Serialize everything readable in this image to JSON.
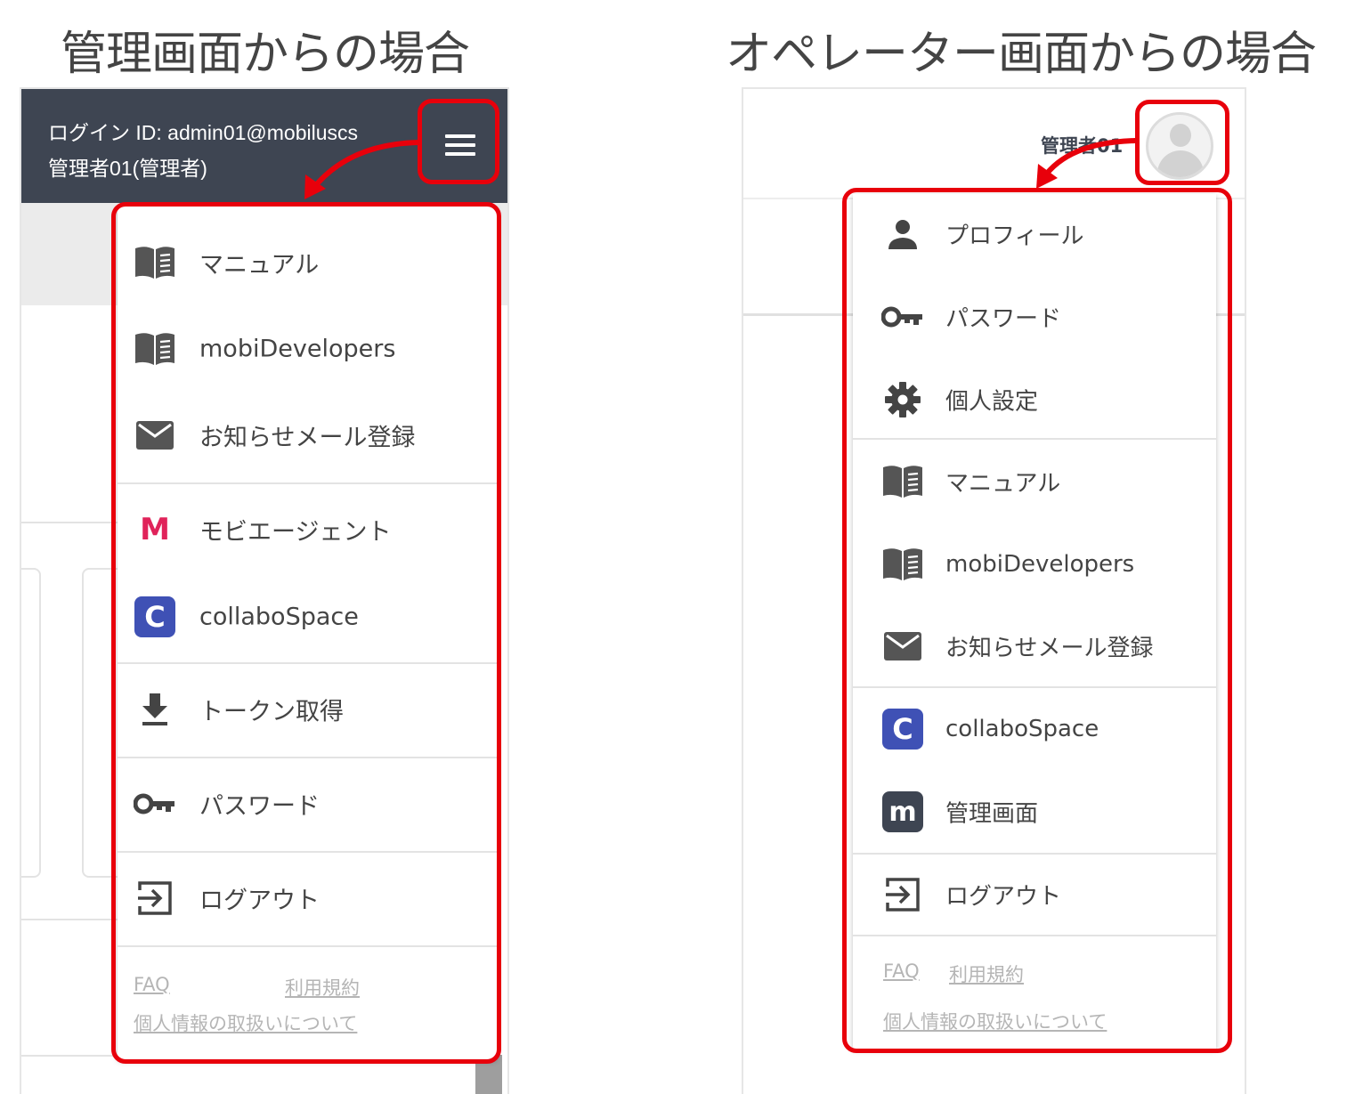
{
  "headings": {
    "admin": "管理画面からの場合",
    "operator": "オペレーター画面からの場合"
  },
  "admin_panel": {
    "login_id_line": "ログイン ID: admin01@mobiluscs",
    "user_line": "管理者01(管理者)",
    "menu_button_icon": "hamburger-icon",
    "menu": {
      "items": [
        {
          "label": "マニュアル",
          "icon": "book-icon"
        },
        {
          "label": "mobiDevelopers",
          "icon": "book-icon"
        },
        {
          "label": "お知らせメール登録",
          "icon": "mail-icon"
        },
        {
          "label": "モビエージェント",
          "icon": "mobi-agent-logo-icon"
        },
        {
          "label": "collaboSpace",
          "icon": "collabospace-logo-icon"
        },
        {
          "label": "トークン取得",
          "icon": "download-icon"
        },
        {
          "label": "パスワード",
          "icon": "key-icon"
        },
        {
          "label": "ログアウト",
          "icon": "logout-icon"
        }
      ],
      "footer": {
        "faq": "FAQ",
        "terms": "利用規約",
        "privacy": "個人情報の取扱いについて"
      }
    }
  },
  "operator_panel": {
    "user_name": "管理者01",
    "avatar_icon": "avatar-icon",
    "menu": {
      "items": [
        {
          "label": "プロフィール",
          "icon": "person-icon"
        },
        {
          "label": "パスワード",
          "icon": "key-icon"
        },
        {
          "label": "個人設定",
          "icon": "gear-icon"
        },
        {
          "label": "マニュアル",
          "icon": "book-icon"
        },
        {
          "label": "mobiDevelopers",
          "icon": "book-icon"
        },
        {
          "label": "お知らせメール登録",
          "icon": "mail-icon"
        },
        {
          "label": "collaboSpace",
          "icon": "collabospace-logo-icon"
        },
        {
          "label": "管理画面",
          "icon": "admin-logo-icon"
        },
        {
          "label": "ログアウト",
          "icon": "logout-icon"
        }
      ],
      "footer": {
        "faq": "FAQ",
        "terms": "利用規約",
        "privacy": "個人情報の取扱いについて"
      }
    }
  },
  "logos": {
    "mobi_agent": "M",
    "collabospace": "C",
    "admin": "m"
  },
  "colors": {
    "header_bg": "#3e4552",
    "highlight_red": "#e8000b",
    "mobi_agent_pink": "#e0235a",
    "collabospace_blue": "#3f51b5",
    "admin_logo_dark": "#3e4552",
    "icon_gray": "#555555"
  }
}
